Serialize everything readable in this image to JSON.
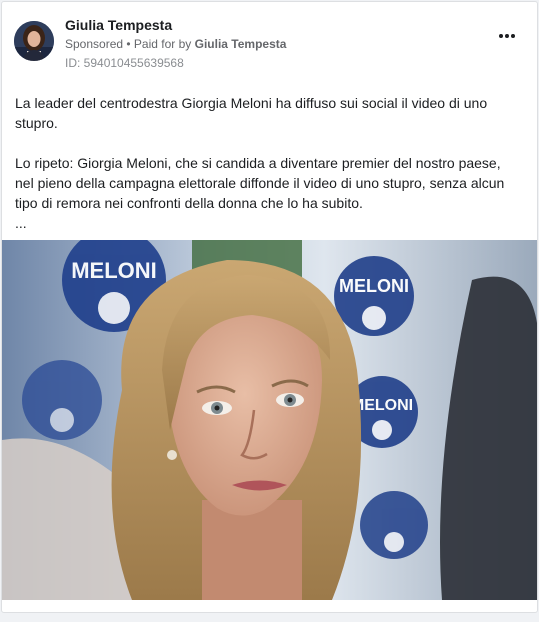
{
  "post": {
    "author": "Giulia Tempesta",
    "sponsored_label": "Sponsored",
    "paid_prefix": " • Paid for by ",
    "paid_by": "Giulia Tempesta",
    "ad_id": "ID: 594010455639568",
    "paragraph_1": "La leader del centrodestra Giorgia Meloni ha diffuso sui social il video di uno stupro.",
    "paragraph_2": "Lo ripeto: Giorgia Meloni, che si candida a diventare premier del nostro paese, nel pieno della campagna elettorale diffonde il video di uno stupro, senza alcun tipo di remora nei confronti della donna che lo ha subito.",
    "see_more": "...",
    "image_logo_text": "MELONI"
  },
  "icons": {
    "more": "more-horizontal-icon"
  }
}
